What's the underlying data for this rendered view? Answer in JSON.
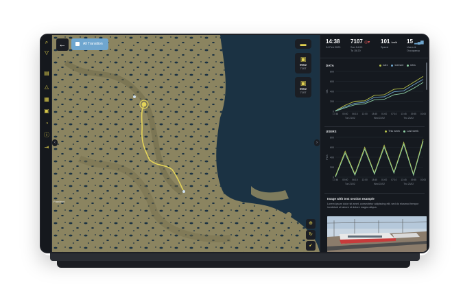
{
  "map": {
    "transition_chip": "All Transition",
    "trains": [
      {
        "num": "9062",
        "sub": "7107"
      },
      {
        "num": "9062",
        "sub": "7107"
      }
    ],
    "city_label": "Frankfurt"
  },
  "stats": [
    {
      "value": "14:38",
      "label": "24 Feb 2023"
    },
    {
      "value": "7107",
      "label": "Sun 14:00\nTo 15:20"
    },
    {
      "value": "101",
      "unit": "km/h",
      "label": "Speed"
    },
    {
      "value": "15",
      "label": "Users &\nOccupancy"
    }
  ],
  "data_section": {
    "title": "DATA",
    "legend": [
      "nat1",
      "tolerant",
      "infra"
    ],
    "colors": [
      "#b7c24b",
      "#6fa6cf",
      "#8fd0a5"
    ]
  },
  "users_section": {
    "title": "USERS",
    "legend": [
      "This week",
      "Last week"
    ],
    "colors": [
      "#b7c24b",
      "#8fd0a5"
    ]
  },
  "chart_data": [
    {
      "type": "line",
      "title": "DATA",
      "ylabel": "GB",
      "x": [
        "17:48",
        "00:00",
        "06:15",
        "12:00",
        "18:45",
        "01:00",
        "07:10",
        "13:45",
        "19:55",
        "02:00"
      ],
      "x_groups": [
        "Tue 21/02",
        "Wed 22/02",
        "Thu 23/02"
      ],
      "yticks": [
        0,
        200,
        400,
        600,
        800
      ],
      "ylim": [
        0,
        800
      ],
      "series": [
        {
          "name": "nat1",
          "values": [
            10,
            120,
            200,
            210,
            320,
            330,
            440,
            460,
            580,
            700
          ]
        },
        {
          "name": "tolerant",
          "values": [
            5,
            90,
            160,
            180,
            280,
            290,
            390,
            410,
            530,
            640
          ]
        },
        {
          "name": "infra",
          "values": [
            0,
            70,
            130,
            150,
            230,
            240,
            330,
            360,
            460,
            580
          ]
        }
      ]
    },
    {
      "type": "line",
      "title": "USERS",
      "ylabel": "PCS",
      "x": [
        "17:48",
        "00:00",
        "06:15",
        "12:00",
        "18:45",
        "01:00",
        "07:10",
        "13:45",
        "19:55",
        "02:00"
      ],
      "x_groups": [
        "Tue 21/02",
        "Wed 22/02",
        "Thu 23/02"
      ],
      "yticks": [
        0,
        200,
        400,
        600,
        800
      ],
      "ylim": [
        0,
        800
      ],
      "series": [
        {
          "name": "This week",
          "values": [
            20,
            520,
            60,
            600,
            80,
            640,
            100,
            700,
            60,
            760
          ]
        },
        {
          "name": "Last week",
          "values": [
            0,
            480,
            40,
            560,
            60,
            600,
            80,
            660,
            40,
            720
          ]
        }
      ]
    }
  ],
  "image_section": {
    "title": "Image with text section example",
    "text": "Lorem ipsum dolor sit amet, consectetur adipiscing elit, sed do eiusmod tempor incididunt ut labore et dolore magna aliqua."
  }
}
